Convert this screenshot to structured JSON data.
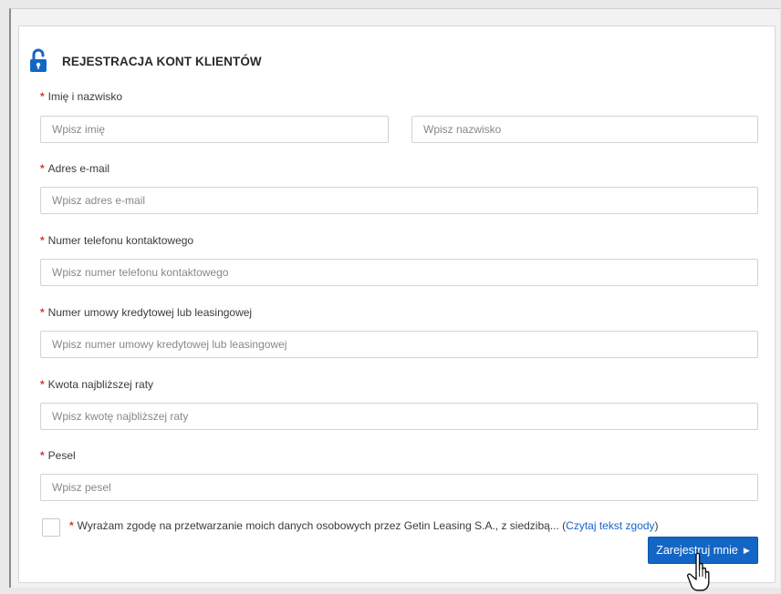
{
  "form": {
    "title": "REJESTRACJA KONT KLIENTÓW",
    "fields": {
      "name": {
        "label": "Imię i nazwisko",
        "first_placeholder": "Wpisz imię",
        "last_placeholder": "Wpisz nazwisko"
      },
      "email": {
        "label": "Adres e-mail",
        "placeholder": "Wpisz adres e-mail"
      },
      "phone": {
        "label": "Numer telefonu kontaktowego",
        "placeholder": "Wpisz numer telefonu kontaktowego"
      },
      "contract": {
        "label": "Numer umowy kredytowej lub leasingowej",
        "placeholder": "Wpisz numer umowy kredytowej lub leasingowej"
      },
      "installment": {
        "label": "Kwota najbliższej raty",
        "placeholder": "Wpisz kwotę najbliższej raty"
      },
      "pesel": {
        "label": "Pesel",
        "placeholder": "Wpisz pesel"
      }
    },
    "required_mark": "*",
    "consent": {
      "text": "Wyrażam zgodę na przetwarzanie moich danych osobowych przez Getin Leasing S.A., z siedzibą... ",
      "link_open": "(",
      "link": "Czytaj tekst zgody",
      "link_close": ")"
    },
    "submit_label": "Zarejestruj mnie",
    "submit_arrow": "▶"
  },
  "colors": {
    "accent": "#1466c6",
    "required": "#d9382e",
    "link": "#1a64c8"
  },
  "icons": {
    "header": "lock-open-icon",
    "cursor": "hand-pointer-icon"
  }
}
